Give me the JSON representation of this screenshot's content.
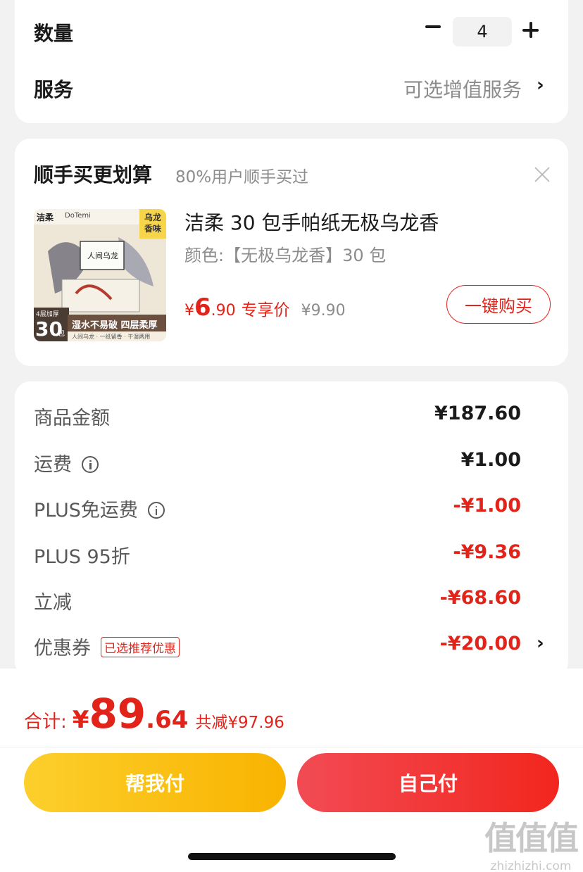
{
  "order": {
    "quantity_label": "数量",
    "quantity_value": "4",
    "service_label": "服务",
    "service_value": "可选增值服务"
  },
  "addon": {
    "title": "顺手买更划算",
    "subtitle": "80%用户顺手买过",
    "product": {
      "name": "洁柔 30 包手帕纸无极乌龙香",
      "spec": "颜色:【无极乌龙香】30 包",
      "price_currency": "¥",
      "price_int": "6",
      "price_dec": ".90",
      "price_tag": "专享价",
      "original_price": "¥9.90",
      "buy_label": "一键购买"
    },
    "thumb": {
      "brand": "洁柔",
      "brand2": "DoTemi",
      "corner_tag": "乌龙香味",
      "pack_label": "4层加厚",
      "count": "30",
      "count_unit": "包",
      "feature": "湿水不易破 四层柔厚",
      "slogan": "人间乌龙 · 一纸留香 · 干湿两用",
      "box_text": "人间乌龙"
    }
  },
  "summary": {
    "rows": [
      {
        "label": "商品金额",
        "value": "¥187.60",
        "red": false
      },
      {
        "label": "运费",
        "value": "¥1.00",
        "red": false,
        "info": true
      },
      {
        "label": "PLUS免运费",
        "value": "-¥1.00",
        "red": true,
        "info": true
      },
      {
        "label": "PLUS 95折",
        "value": "-¥9.36",
        "red": true
      },
      {
        "label": "立减",
        "value": "-¥68.60",
        "red": true
      },
      {
        "label": "优惠券",
        "value": "-¥20.00",
        "red": true,
        "badge": "已选推荐优惠"
      }
    ]
  },
  "total": {
    "label": "合计:",
    "currency": "¥",
    "int": "89",
    "dec": ".64",
    "saved": "共减¥97.96"
  },
  "actions": {
    "help_pay": "帮我付",
    "self_pay": "自己付"
  },
  "watermark": {
    "big": "值值值",
    "small": "zhizhizhi.com"
  },
  "colors": {
    "accent_red": "#e2231a",
    "yellow_button": "#f9b300",
    "red_button": "#f2261e"
  }
}
